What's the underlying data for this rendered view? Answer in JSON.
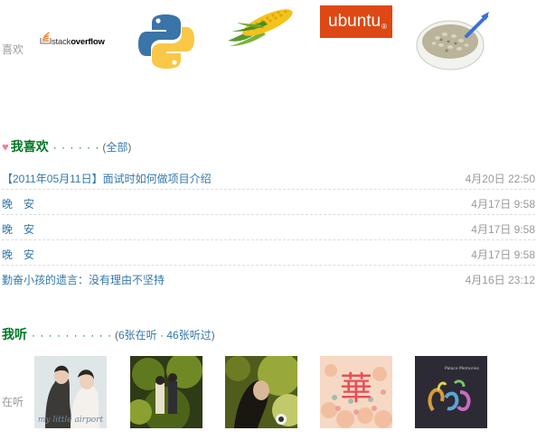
{
  "likes": {
    "label": "喜欢",
    "items": [
      {
        "name": "stackoverflow",
        "text_prefix": "stack",
        "text_bold": "overflow",
        "icon": "stackoverflow-logo"
      },
      {
        "name": "python",
        "icon": "python-logo"
      },
      {
        "name": "corn",
        "icon": "corn-image"
      },
      {
        "name": "ubuntu",
        "text": "ubuntu",
        "mark": "®",
        "icon": "ubuntu-logo",
        "color": "#dd4814"
      },
      {
        "name": "soup",
        "icon": "soup-bowl-image"
      }
    ]
  },
  "my_likes": {
    "title": "我喜欢",
    "dots": "· · · · · ·",
    "open_paren": "(",
    "all_link": "全部",
    "close_paren": ")",
    "items": [
      {
        "title": "【2011年05月11日】面试时如何做项目介绍",
        "time": "4月20日 22:50"
      },
      {
        "title": "晚　安",
        "time": "4月17日 9:58"
      },
      {
        "title": "晚　安",
        "time": "4月17日 9:58"
      },
      {
        "title": "晚　安",
        "time": "4月17日 9:58"
      },
      {
        "title": "勤奋小孩的遗言：没有理由不坚持",
        "time": "4月16日 23:12"
      }
    ]
  },
  "listening": {
    "title": "我听",
    "dots": "· · · · · · · · · ·",
    "open_paren": "(",
    "now_link": "6张在听",
    "sep": "·",
    "done_link": "46张听过",
    "close_paren": ")",
    "label": "在听",
    "albums": [
      {
        "caption": "my little airport",
        "icon": "album-cover-1"
      },
      {
        "icon": "album-cover-2"
      },
      {
        "icon": "album-cover-3"
      },
      {
        "glyph": "華",
        "icon": "album-cover-4"
      },
      {
        "caption": "Palace Memories",
        "icon": "album-cover-5"
      }
    ]
  },
  "colors": {
    "link": "#3377aa",
    "section_title": "#007722",
    "heart": "#f07f95",
    "meta": "#999999"
  }
}
